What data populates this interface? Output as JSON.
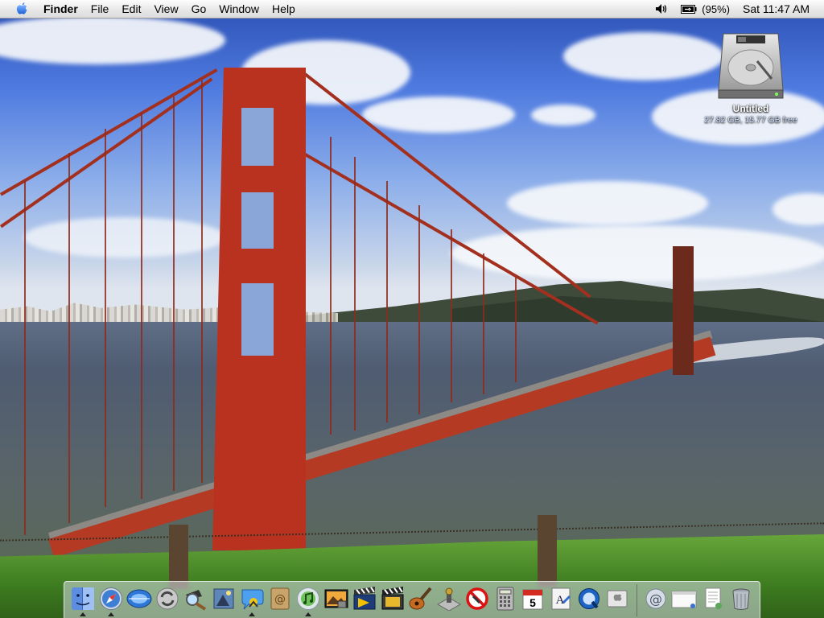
{
  "menubar": {
    "apple_icon": "apple-icon",
    "app_name": "Finder",
    "menus": [
      "File",
      "Edit",
      "View",
      "Go",
      "Window",
      "Help"
    ],
    "volume_icon": "speaker-icon",
    "battery_icon": "battery-icon",
    "battery_percent": "(95%)",
    "clock": "Sat 11:47 AM"
  },
  "desktop": {
    "drive": {
      "icon": "hard-drive-icon",
      "name": "Untitled",
      "info": "27.82 GB, 15.77 GB free"
    }
  },
  "dock": {
    "apps": [
      {
        "name": "finder-icon",
        "running": true
      },
      {
        "name": "safari-icon",
        "running": true
      },
      {
        "name": "internet-explorer-icon",
        "running": false
      },
      {
        "name": "isync-icon",
        "running": false
      },
      {
        "name": "sherlock-icon",
        "running": false
      },
      {
        "name": "preview-icon",
        "running": false
      },
      {
        "name": "ichat-icon",
        "running": true
      },
      {
        "name": "address-book-icon",
        "running": false
      },
      {
        "name": "itunes-icon",
        "running": true
      },
      {
        "name": "iphoto-icon",
        "running": false
      },
      {
        "name": "imovie-icon",
        "running": false
      },
      {
        "name": "final-cut-icon",
        "running": false
      },
      {
        "name": "garageband-icon",
        "running": false
      },
      {
        "name": "system-preferences-icon",
        "running": false
      },
      {
        "name": "no-entry-icon",
        "running": false
      },
      {
        "name": "calculator-icon",
        "running": false
      },
      {
        "name": "ical-icon",
        "running": false
      },
      {
        "name": "font-book-icon",
        "running": false
      },
      {
        "name": "quicktime-icon",
        "running": false
      },
      {
        "name": "apple-store-icon",
        "running": false
      }
    ],
    "docs": [
      {
        "name": "mail-icon"
      },
      {
        "name": "window-icon"
      },
      {
        "name": "document-icon"
      },
      {
        "name": "trash-icon"
      }
    ],
    "ical_day": "5"
  },
  "colors": {
    "bridge_red": "#b8321f",
    "sky_blue": "#4f7be0",
    "menubar_bg": "#e6e6e6"
  }
}
